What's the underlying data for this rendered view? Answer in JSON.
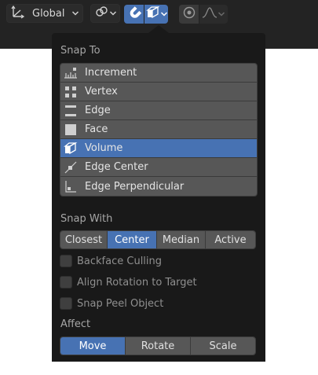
{
  "header": {
    "orientation_label": "Global",
    "icons": {
      "orientation": "transform-orientation-icon",
      "pivot": "pivot-point-icon",
      "snap": "magnet-snap-icon",
      "snap_element": "volume-cube-icon",
      "proportional": "proportional-editing-icon",
      "falloff": "falloff-curve-icon"
    }
  },
  "popup": {
    "snap_to": {
      "heading": "Snap To",
      "items": [
        {
          "label": "Increment",
          "icon": "increment-icon",
          "active": false
        },
        {
          "label": "Vertex",
          "icon": "vertex-icon",
          "active": false
        },
        {
          "label": "Edge",
          "icon": "edge-icon",
          "active": false
        },
        {
          "label": "Face",
          "icon": "face-icon",
          "active": false
        },
        {
          "label": "Volume",
          "icon": "volume-icon",
          "active": true
        },
        {
          "label": "Edge Center",
          "icon": "edge-center-icon",
          "active": false
        },
        {
          "label": "Edge Perpendicular",
          "icon": "edge-perpendicular-icon",
          "active": false
        }
      ]
    },
    "snap_with": {
      "heading": "Snap With",
      "options": [
        "Closest",
        "Center",
        "Median",
        "Active"
      ],
      "selected": "Center"
    },
    "options": [
      {
        "label": "Backface Culling",
        "checked": false
      },
      {
        "label": "Align Rotation to Target",
        "checked": false
      },
      {
        "label": "Snap Peel Object",
        "checked": false
      }
    ],
    "affect": {
      "heading": "Affect",
      "options": [
        "Move",
        "Rotate",
        "Scale"
      ],
      "selected": [
        "Move"
      ]
    }
  },
  "colors": {
    "accent": "#4772b3",
    "button": "#575757",
    "popup_bg": "#191919",
    "header_bg": "#232323"
  }
}
